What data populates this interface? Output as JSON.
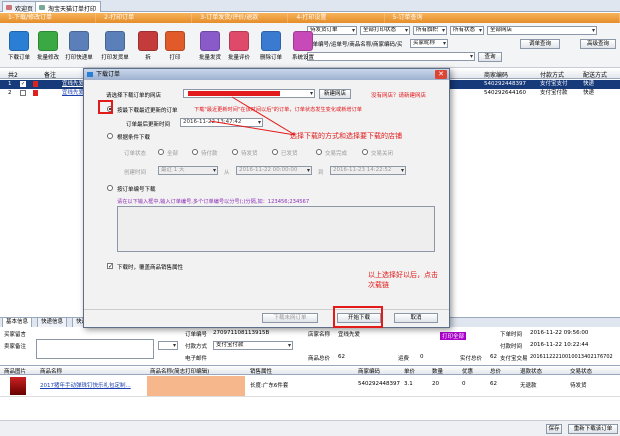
{
  "tabs": [
    {
      "label": "欢迎页"
    },
    {
      "label": "淘宝天猫订单打印"
    }
  ],
  "steps": [
    "1-下载/修改订单",
    "2-打印订单",
    "3-订单发货/评价/退款",
    "4-打印设置",
    "5-订单查询"
  ],
  "toolbar": {
    "buttons": [
      {
        "label": "下载订单",
        "color": "#2a7fd4"
      },
      {
        "label": "批量修改",
        "color": "#3aa843"
      },
      {
        "label": "打印快递单",
        "color": "#5b7fb8"
      },
      {
        "label": "打印发货单",
        "color": "#5b7fb8"
      },
      {
        "label": "拆",
        "color": "#c43b3b"
      },
      {
        "label": "打印",
        "color": "#e05a2a"
      },
      {
        "label": "批量发货",
        "color": "#8a5ac8"
      },
      {
        "label": "批量评价",
        "color": "#e04a6a"
      },
      {
        "label": "删除订单",
        "color": "#3a7ad0"
      },
      {
        "label": "系统设置",
        "color": "#c84ab8"
      }
    ],
    "filters": {
      "f1": "待发货订单",
      "f2": "全部打印状态",
      "f3": "所有旗帜",
      "f4": "所有状态",
      "f5": "全部网店"
    },
    "search_label": "订单编号/运单号/商品名称/商家编码/买",
    "f6": "买家昵称",
    "query_btn": "查询",
    "sync_btn": "调单查询",
    "advanced_btn": "高级查询"
  },
  "grid": {
    "headers": [
      "共2",
      "",
      "备注",
      "商家编码",
      "付款方式",
      "配送方式"
    ],
    "rows": [
      {
        "num": "1",
        "name": "宜线先爱",
        "code": "540292448397",
        "pay": "支付宝支付",
        "ship": "快递"
      },
      {
        "num": "2",
        "name": "宜线先爱",
        "code": "540292644160",
        "pay": "支付宝付款",
        "ship": "快递"
      }
    ]
  },
  "modal": {
    "title": "下载订单",
    "shop_label": "请选择下载订单的网店",
    "new_shop_btn": "新建网店",
    "no_shop_link": "没有网店？请新建网店",
    "opt1_label": "按最下载最近更新的订单",
    "opt1_hint": "下载\"最近更新时间\"在该时间以后\"的订单，订单状态发生变化或新增订单",
    "time_label": "订单最后更新时间",
    "time_value": "2016-11-22 13:47:42",
    "opt2_label": "根据条件下载",
    "status_label": "订单状态",
    "status_opts": [
      "全部",
      "待付款",
      "待发货",
      "已发货",
      "交易完成",
      "交易关闭"
    ],
    "created_label": "创建时间",
    "created_preset": "最近 1 天",
    "from_label": "从",
    "from_value": "2016-11-22 00:00:00",
    "to_label": "到",
    "to_value": "2016-11-23 14:22:52",
    "opt3_label": "按订单编号下载",
    "opt3_hint": "请在以下输入框中,输入订单编号,多个订单编号以分号(;)分隔,如：123456;234567",
    "cover_label": "下载时，覆盖商品销售属性",
    "download_shop_btn": "下载未网订单",
    "start_btn": "开始下载",
    "cancel_btn": "取消"
  },
  "annotations": {
    "a1": "选择下载的方式和选择要下载的店铺",
    "a2": "以上选择好以后，点击",
    "a3": "次载链"
  },
  "bottom_tabs": [
    "基本信息",
    "快递信息",
    "快递跟踪"
  ],
  "detail": {
    "buyer_nick": "买家留言",
    "seller_note": "卖家备注",
    "order_no_label": "订单编号",
    "order_no": "270971108113915B",
    "shop_label": "店家名称",
    "shop_value": "宜线先爱",
    "pay_label": "付款方式",
    "pay_value": "支付宝付款",
    "ebill_label": "电子邮件",
    "goods_total_label": "商品总价",
    "goods_total": "62",
    "freight_label": "运费",
    "freight": "0",
    "actual_label": "实付总价",
    "actual": "62",
    "order_time_label": "下单时间",
    "order_time": "2016-11-22 09:56:00",
    "pay_time_label": "付款时间",
    "pay_time": "2016-11-22 10:22:44",
    "alipay_label": "支付宝交易",
    "alipay_no": "20161122210010013402176702",
    "star_label": "星标",
    "badge": "打印全部"
  },
  "items": {
    "headers": [
      "商品图片",
      "商品名称",
      "商品名称(简志打印编辑)",
      "销售属性",
      "商家编码",
      "单价",
      "数量",
      "优惠",
      "总价",
      "退款状态",
      "交易状态"
    ],
    "row": {
      "name": "2017猪年手动弹珠钉快乐礼包定制...",
      "prop": "长度:广东6件套",
      "code": "540292448397",
      "price": "3.1",
      "qty": "20",
      "disc": "0",
      "total": "62",
      "refund": "无退款",
      "status": "待发货"
    }
  },
  "footer": {
    "save_btn": "保存",
    "redownload_btn": "重新下载该订单"
  }
}
